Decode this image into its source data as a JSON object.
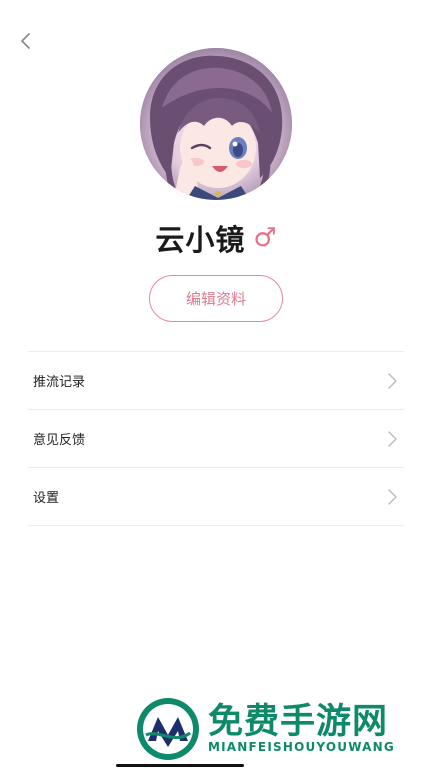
{
  "header": {
    "back_icon": "chevron-left-icon"
  },
  "profile": {
    "avatar_icon": "anime-girl-avatar",
    "name": "云小镜",
    "gender_symbol": "♂",
    "gender_color": "#e8718a",
    "edit_button_label": "编辑资料",
    "accent_color": "#e9889c"
  },
  "menu": {
    "items": [
      {
        "label": "推流记录",
        "icon": "chevron-right-icon"
      },
      {
        "label": "意见反馈",
        "icon": "chevron-right-icon"
      },
      {
        "label": "设置",
        "icon": "chevron-right-icon"
      }
    ]
  },
  "watermark": {
    "title": "免费手游网",
    "subtitle": "MIANFEISHOUYOUWANG",
    "color": "#0e8a6a"
  }
}
